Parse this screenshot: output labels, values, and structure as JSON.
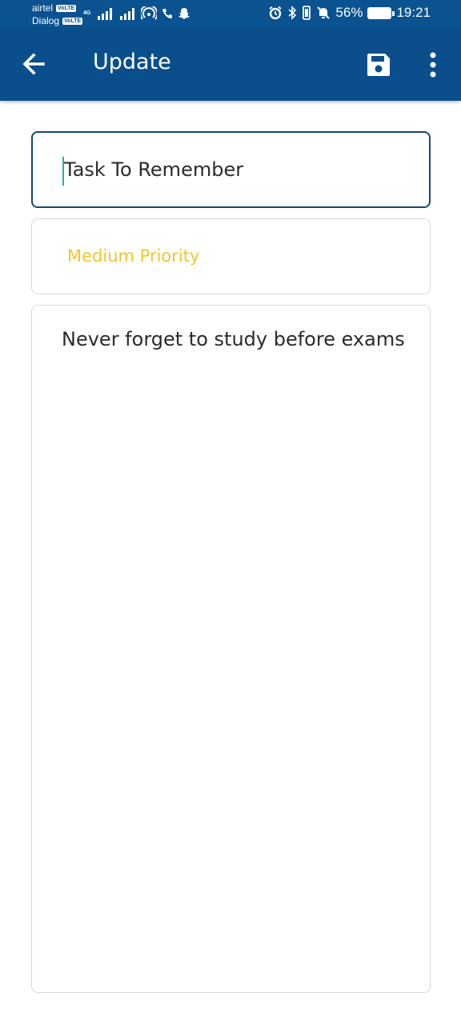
{
  "status_bar": {
    "carrier1": "airtel",
    "carrier2": "Dialog",
    "volte_label": "VoLTE",
    "network_type": "4G",
    "battery_percent": "56%",
    "time": "19:21",
    "icons": [
      "signal-icon",
      "hotspot-icon",
      "call-icon",
      "snapchat-icon",
      "alarm-icon",
      "bluetooth-icon",
      "vibrate-icon",
      "mute-icon",
      "battery-icon"
    ]
  },
  "app_bar": {
    "title": "Update",
    "icons": [
      "back-arrow-icon",
      "save-icon",
      "more-vert-icon"
    ],
    "background_color": "#0a4f8c"
  },
  "form": {
    "title_value": "Task To Remember",
    "priority_value": "Medium Priority",
    "priority_color": "#f3c52a",
    "description_value": "Never forget to study before exams"
  }
}
